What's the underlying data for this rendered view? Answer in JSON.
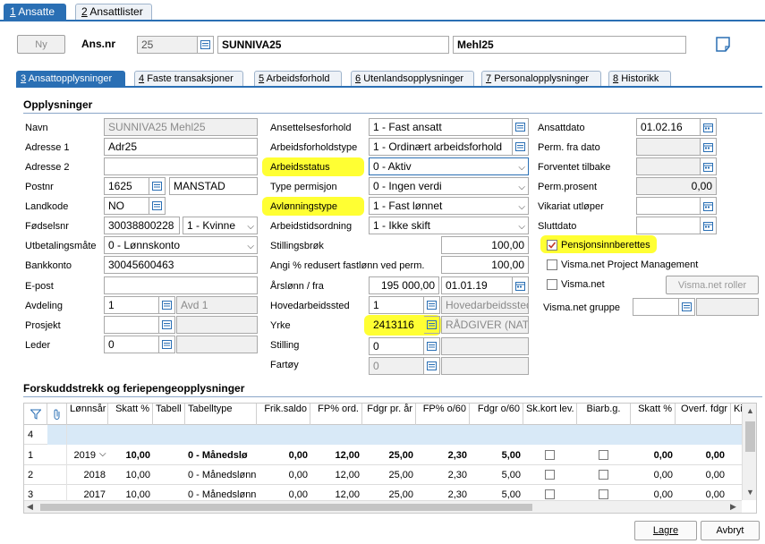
{
  "top_tabs": [
    {
      "num": "1",
      "label": "Ansatte"
    },
    {
      "num": "2",
      "label": "Ansattlister"
    }
  ],
  "header": {
    "ny_label": "Ny",
    "ansnr_label": "Ans.nr",
    "ansnr_value": "25",
    "firstname": "SUNNIVA25",
    "lastname": "Mehl25"
  },
  "sub_tabs": [
    {
      "num": "3",
      "label": "Ansattopplysninger"
    },
    {
      "num": "4",
      "label": "Faste transaksjoner"
    },
    {
      "num": "5",
      "label": "Arbeidsforhold"
    },
    {
      "num": "6",
      "label": "Utenlandsopplysninger"
    },
    {
      "num": "7",
      "label": "Personalopplysninger"
    },
    {
      "num": "8",
      "label": "Historikk"
    }
  ],
  "section1_title": "Opplysninger",
  "col1": {
    "navn_label": "Navn",
    "navn": "SUNNIVA25 Mehl25",
    "adresse1_label": "Adresse 1",
    "adresse1": "Adr25",
    "adresse2_label": "Adresse 2",
    "adresse2": "",
    "postnr_label": "Postnr",
    "postnr": "1625",
    "poststed": "MANSTAD",
    "landkode_label": "Landkode",
    "landkode": "NO",
    "fodselsnr_label": "Fødselsnr",
    "fodselsnr": "30038800228",
    "kjonn": "1 - Kvinne",
    "utbetaling_label": "Utbetalingsmåte",
    "utbetaling": "0 - Lønnskonto",
    "bankkonto_label": "Bankkonto",
    "bankkonto": "30045600463",
    "epost_label": "E-post",
    "epost": "",
    "avdeling_label": "Avdeling",
    "avdeling": "1",
    "avdeling_name": "Avd 1",
    "prosjekt_label": "Prosjekt",
    "prosjekt": "",
    "leder_label": "Leder",
    "leder": "0"
  },
  "col2": {
    "ansettelsesforhold_label": "Ansettelsesforhold",
    "ansettelsesforhold": "1 - Fast ansatt",
    "arbeidsforholdstype_label": "Arbeidsforholdstype",
    "arbeidsforholdstype": "1 - Ordinært arbeidsforhold",
    "arbeidsstatus_label": "Arbeidsstatus",
    "arbeidsstatus": "0 - Aktiv",
    "typepermisjon_label": "Type permisjon",
    "typepermisjon": "0 - Ingen verdi",
    "avlonningstype_label": "Avlønningstype",
    "avlonningstype": "1 - Fast lønnet",
    "arbeidstidsordning_label": "Arbeidstidsordning",
    "arbeidstidsordning": "1 - Ikke skift",
    "stillingsbrok_label": "Stillingsbrøk",
    "stillingsbrok": "100,00",
    "redusert_label": "Angi % redusert fastlønn ved perm.",
    "redusert": "100,00",
    "arslonn_label": "Årslønn / fra",
    "arslonn": "195 000,00",
    "arslonn_fra": "01.01.19",
    "hovedarbeidssted_label": "Hovedarbeidssted",
    "hovedarbeidssted": "1",
    "hovedarbeidssted_name": "Hovedarbeidssted",
    "yrke_label": "Yrke",
    "yrke": "2413116",
    "yrke_name": "RÅDGIVER (NAT",
    "stilling_label": "Stilling",
    "stilling": "0",
    "fartoy_label": "Fartøy",
    "fartoy": "0"
  },
  "col3": {
    "ansattdato_label": "Ansattdato",
    "ansattdato": "01.02.16",
    "permfra_label": "Perm. fra dato",
    "permfra": "",
    "forventet_label": "Forventet tilbake",
    "forventet": "",
    "permprosent_label": "Perm.prosent",
    "permprosent": "0,00",
    "vikariat_label": "Vikariat utløper",
    "vikariat": "",
    "sluttdato_label": "Sluttdato",
    "sluttdato": "",
    "pensjon_label": "Pensjonsinnberettes",
    "vnpm_label": "Visma.net Project Management",
    "vn_label": "Visma.net",
    "vnroller_label": "Visma.net roller",
    "vngruppe_label": "Visma.net gruppe"
  },
  "section2_title": "Forskuddstrekk og feriepengeopplysninger",
  "grid": {
    "headers": [
      "Lønnsår",
      "Skatt %",
      "Tabell",
      "Tabelltype",
      "Frik.saldo",
      "FP% ord.",
      "Fdgr pr. år",
      "FP% o/60",
      "Fdgr o/60",
      "Sk.kort lev.",
      "Biarb.g.",
      "Skatt %",
      "Overf. fdgr",
      "Ki"
    ],
    "rows": [
      {
        "num": "4",
        "cells": [
          "",
          "",
          "",
          "",
          "",
          "",
          "",
          "",
          "",
          "",
          "",
          "",
          ""
        ]
      },
      {
        "num": "1",
        "cells": [
          "2019",
          "10,00",
          "",
          "0 - Månedslø",
          "0,00",
          "12,00",
          "25,00",
          "2,30",
          "5,00",
          "",
          "",
          "0,00",
          "0,00"
        ]
      },
      {
        "num": "2",
        "cells": [
          "2018",
          "10,00",
          "",
          "0 - Månedslønn",
          "0,00",
          "12,00",
          "25,00",
          "2,30",
          "5,00",
          "",
          "",
          "0,00",
          "0,00"
        ]
      },
      {
        "num": "3",
        "cells": [
          "2017",
          "10,00",
          "",
          "0 - Månedslønn",
          "0,00",
          "12,00",
          "25,00",
          "2,30",
          "5,00",
          "",
          "",
          "0,00",
          "0,00"
        ]
      }
    ]
  },
  "footer": {
    "save_label": "Lagre",
    "cancel_label": "Avbryt"
  },
  "colors": {
    "accent": "#2a6fb4",
    "highlight": "#ffff33"
  }
}
